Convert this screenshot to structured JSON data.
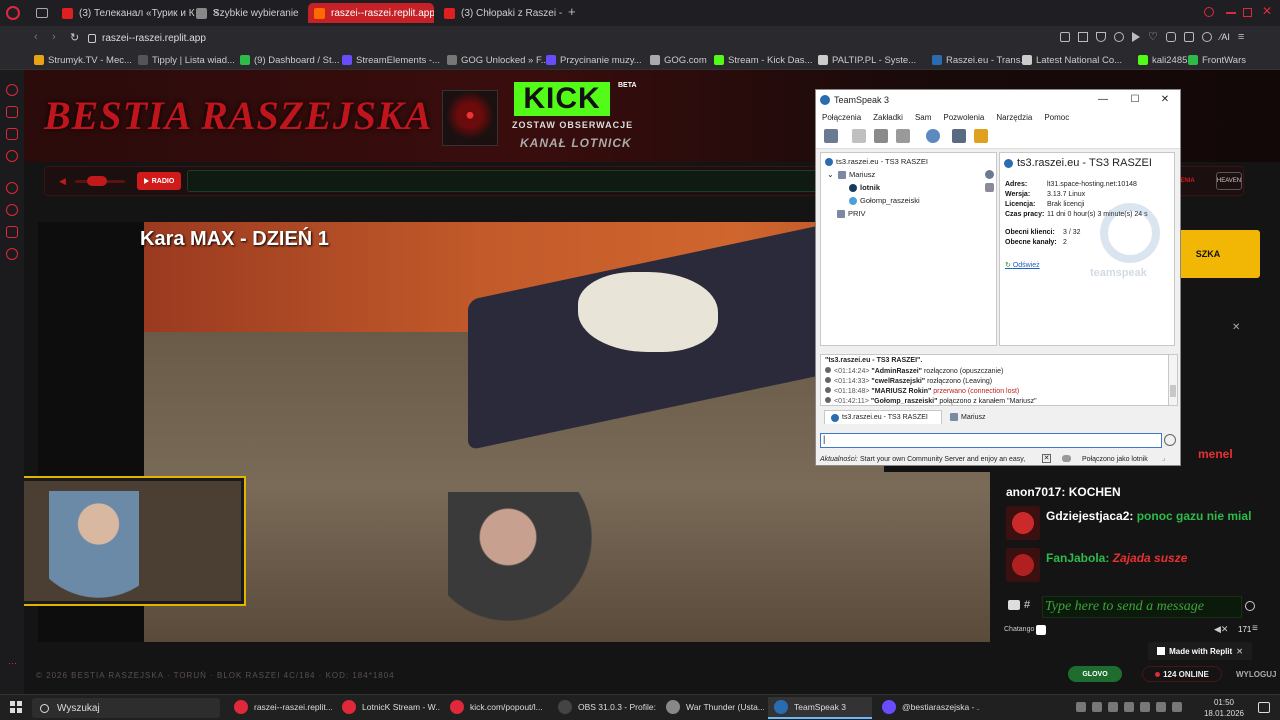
{
  "browser": {
    "tabs": [
      {
        "label": "(3) Телеканал «Турик и К",
        "color": "#e02020",
        "active": false
      },
      {
        "label": "Szybkie wybieranie",
        "color": "#888888",
        "active": false
      },
      {
        "label": "raszei--raszei.replit.app",
        "color": "#ff6a00",
        "active": true
      },
      {
        "label": "(3) Chłopaki z Raszei - PR",
        "color": "#e02020",
        "active": false
      }
    ],
    "url": "raszei--raszei.replit.app",
    "bookmarks": [
      {
        "label": "Strumyk.TV - Mec...",
        "color": "#e8a317"
      },
      {
        "label": "Tipply | Lista wiad...",
        "color": "#555555"
      },
      {
        "label": "(9) Dashboard / St...",
        "color": "#2dbb4a"
      },
      {
        "label": "StreamElements -...",
        "color": "#6a4cff"
      },
      {
        "label": "GOG Unlocked » F...",
        "color": "#777777"
      },
      {
        "label": "Przycinanie muzy...",
        "color": "#6a4cff"
      },
      {
        "label": "GOG.com",
        "color": "#aaaaaa"
      },
      {
        "label": "Stream - Kick Das...",
        "color": "#53fc18"
      },
      {
        "label": "PALTIP.PL - Syste...",
        "color": "#cccccc"
      },
      {
        "label": "Raszei.eu - Trans...",
        "color": "#2a6cb0"
      },
      {
        "label": "Latest National Co...",
        "color": "#cccccc"
      },
      {
        "label": "kali24853",
        "color": "#53fc18"
      },
      {
        "label": "FrontWars",
        "color": "#2dbb4a"
      }
    ]
  },
  "page": {
    "banner_title": "BESTIA RASZEJSKA",
    "kick_logo": "KICK",
    "kick_badge": "BETA",
    "kick_tagline": "ZOSTAW OBSERWACJE",
    "kick_channel": "KANAŁ LOTNICK",
    "radio_label": "RADIO",
    "zdrowienia": "ZDROWIENIA",
    "heaven": "HEAVEN",
    "video_title": "Kara MAX - DZIEŃ 1",
    "overlay_btn": "SZKA",
    "chat": {
      "messages": [
        {
          "user": "",
          "text": "menel",
          "user_color": "#e83030",
          "text_color": "#e83030",
          "avatar": ""
        },
        {
          "user": "anon7017:",
          "text": "KOCHEN",
          "user_color": "#ffffff",
          "text_color": "#ffffff",
          "avatar": ""
        },
        {
          "user": "Gdziejestjaca2:",
          "text": "ponoc gazu nie mial",
          "user_color": "#ffffff",
          "text_color": "#2dbb4a",
          "avatar": "#cc2a2a"
        },
        {
          "user": "FanJabola:",
          "text": "Zajada susze",
          "user_color": "#2dbb4a",
          "text_color": "#e83030",
          "avatar": "#b02020"
        }
      ],
      "hash": "#",
      "input_placeholder": "Type here to send a message",
      "chatango": "Chatango",
      "count": "171"
    },
    "footer": "© 2026 BESTIA RASZEJSKA · TORUŃ · BLOK RASZEI 4C/184 · KOD: 184*1804",
    "glovo": "GLOVO",
    "online": "124 ONLINE",
    "logout": "WYLOGUJ",
    "replit": "Made with Replit"
  },
  "teamspeak": {
    "title": "TeamSpeak 3",
    "menu": [
      "Połączenia",
      "Zakładki",
      "Sam",
      "Pozwolenia",
      "Narzędzia",
      "Pomoc"
    ],
    "tree": {
      "server": "ts3.raszei.eu - TS3 RASZEI",
      "channels": [
        {
          "name": "Mariusz",
          "clients": [
            "lotnik",
            "Gołomp_raszeiski"
          ]
        },
        {
          "name": "PRIV",
          "clients": []
        }
      ]
    },
    "info": {
      "title": "ts3.raszei.eu - TS3 RASZEI",
      "rows": [
        {
          "k": "Adres:",
          "v": "lt31.space-hosting.net:10148"
        },
        {
          "k": "Wersja:",
          "v": "3.13.7 Linux"
        },
        {
          "k": "Licencja:",
          "v": "Brak licencji"
        },
        {
          "k": "Czas pracy:",
          "v": "11 dni 0 hour(s) 3 minute(s) 24 s"
        }
      ],
      "rows2": [
        {
          "k": "Obecni klienci:",
          "v": "3 / 32"
        },
        {
          "k": "Obecne kanały:",
          "v": "2"
        }
      ],
      "refresh": "Odśwież",
      "watermark": "teamspeak"
    },
    "log": [
      {
        "time": "",
        "name": "\"ts3.raszei.eu - TS3 RASZEI\".",
        "text": "",
        "color": "#222222"
      },
      {
        "time": "<01:14:24>",
        "name": "\"AdminRaszei\"",
        "text": "rozłączono (opuszczanie)",
        "color": "#222222"
      },
      {
        "time": "<01:14:33>",
        "name": "\"cwelRaszejski\"",
        "text": "rozłączono (Leaving)",
        "color": "#222222"
      },
      {
        "time": "<01:18:48>",
        "name": "\"MARIUSZ Rokin\"",
        "text": "przerwano (connection lost)",
        "color": "#c02020"
      },
      {
        "time": "<01:42:11>",
        "name": "\"Gołomp_raszeiski\"",
        "text": "połączono z kanałem \"Mariusz\"",
        "color": "#222222"
      }
    ],
    "tabs": [
      "ts3.raszei.eu - TS3 RASZEI",
      "Mariusz"
    ],
    "input_value": "|",
    "status_news_label": "Aktualności:",
    "status_news": "Start your own Community Server and enjoy an easy,",
    "status_connected": "Połączono jako lotnik"
  },
  "taskbar": {
    "search": "Wyszukaj",
    "apps": [
      {
        "label": "raszei--raszei.replit...",
        "color": "#e0283b",
        "active": false
      },
      {
        "label": "LotnicK Stream - W...",
        "color": "#e0283b",
        "active": false
      },
      {
        "label": "kick.com/popout/l...",
        "color": "#e0283b",
        "active": false
      },
      {
        "label": "OBS 31.0.3 - Profile:...",
        "color": "#444444",
        "active": false
      },
      {
        "label": "War Thunder (Usta...",
        "color": "#888888",
        "active": false
      },
      {
        "label": "TeamSpeak 3",
        "color": "#2a6cb0",
        "active": true
      },
      {
        "label": "@bestiaraszejska - ...",
        "color": "#6a4cff",
        "active": false
      }
    ],
    "time": "01:50",
    "date": "18.01.2026"
  }
}
